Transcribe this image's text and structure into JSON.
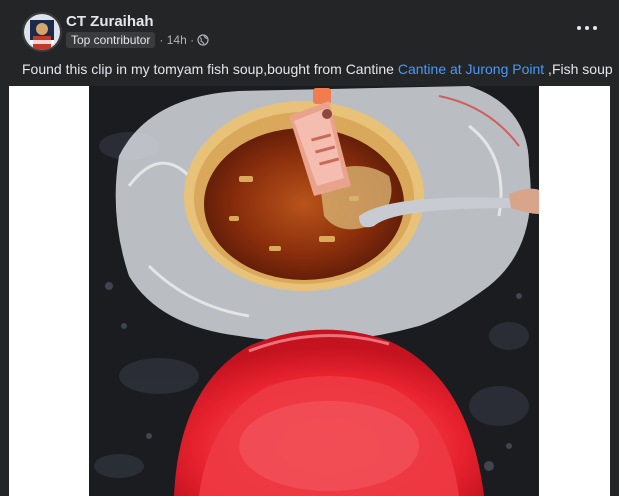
{
  "post": {
    "author": "CT Zuraihah",
    "badge": "Top contributor",
    "time": "· 14h ·",
    "privacy_icon": "globe-icon",
    "more_icon": "more-horizontal-icon",
    "text_prefix": "Found this clip in my tomyam fish soup,bought from Cantine ",
    "link_text": "Cantine at Jurong Point",
    "text_suffix": " ,Fish soup"
  },
  "colors": {
    "background": "#242526",
    "text": "#e4e6eb",
    "secondary_text": "#b0b3b8",
    "link": "#4599ff",
    "badge_bg": "#3a3b3c"
  }
}
